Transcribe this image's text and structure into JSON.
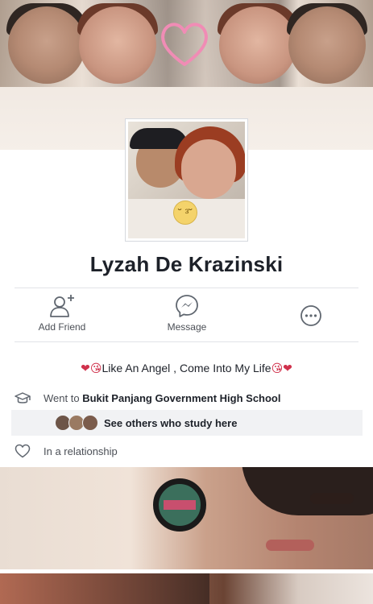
{
  "profile": {
    "name": "Lyzah De Krazinski"
  },
  "actions": {
    "add_friend": "Add Friend",
    "message": "Message"
  },
  "bio": {
    "prefix_emoji": "❤😘",
    "text": "Like An Angel , Come Into My Life",
    "suffix_emoji": "😘❤"
  },
  "education": {
    "prefix": "Went to ",
    "school": "Bukit Panjang Government High School",
    "others_label": "See others who study here"
  },
  "relationship": {
    "status": "In a relationship"
  },
  "colors": {
    "primary_text": "#1d2129",
    "secondary_text": "#4b4f56",
    "icon_gray": "#606770",
    "divider": "#e1e3e7",
    "highlight_bg": "#f1f2f4",
    "heart_pink": "#f08cb5"
  },
  "icons": {
    "add_friend": "person-plus-icon",
    "message": "messenger-icon",
    "more": "more-dots-icon",
    "education": "graduation-cap-icon",
    "relationship": "heart-outline-icon"
  }
}
